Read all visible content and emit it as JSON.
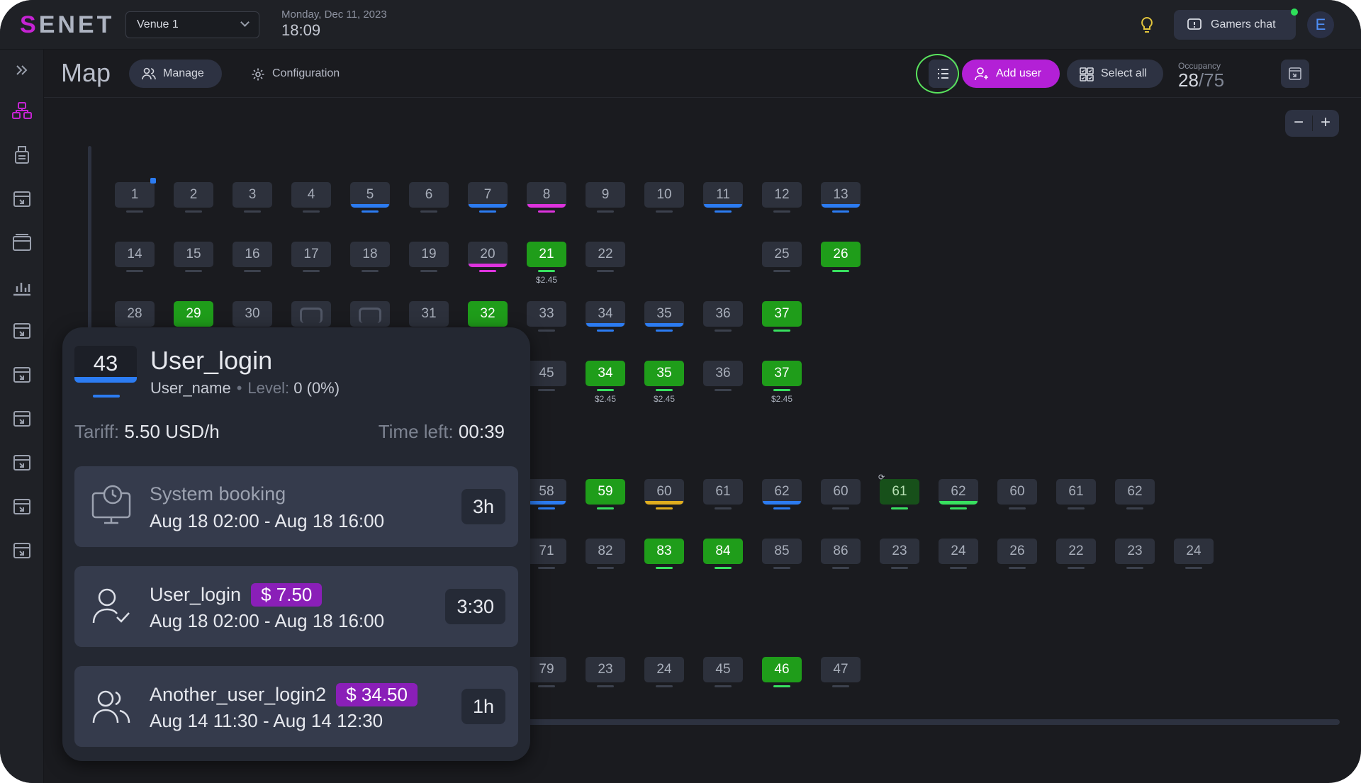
{
  "app": {
    "logo_s": "S",
    "logo_rest": "ENET",
    "venue": "Venue 1",
    "date": "Monday, Dec 11, 2023",
    "time": "18:09",
    "chat_label": "Gamers chat",
    "avatar_letter": "E",
    "brand_color": "#c623d4"
  },
  "header": {
    "title": "Map",
    "manage_label": "Manage",
    "config_label": "Configuration",
    "add_user_label": "Add user",
    "select_all_label": "Select all",
    "occupancy_label": "Occupancy",
    "occupancy_value": "28",
    "occupancy_total": "/75"
  },
  "zoom": {
    "minus": "−",
    "plus": "+"
  },
  "sidebar": {
    "icons": [
      "chevrons-right-icon",
      "map-icon",
      "printer-icon",
      "plugin-icon",
      "window-icon",
      "bar-chart-icon",
      "plugin-icon",
      "plugin-icon",
      "plugin-icon",
      "plugin-icon",
      "plugin-icon",
      "plugin-icon"
    ]
  },
  "computers": [
    {
      "n": "1",
      "state": "idle",
      "dot": true
    },
    {
      "n": "2",
      "state": "idle"
    },
    {
      "n": "3",
      "state": "idle"
    },
    {
      "n": "4",
      "state": "idle"
    },
    {
      "n": "5",
      "state": "idle",
      "accent": "blue"
    },
    {
      "n": "6",
      "state": "idle"
    },
    {
      "n": "7",
      "state": "idle",
      "accent": "blue"
    },
    {
      "n": "8",
      "state": "idle",
      "accent": "pink"
    },
    {
      "n": "9",
      "state": "idle"
    },
    {
      "n": "10",
      "state": "idle"
    },
    {
      "n": "11",
      "state": "idle",
      "accent": "blue"
    },
    {
      "n": "12",
      "state": "idle"
    },
    {
      "n": "13",
      "state": "idle",
      "accent": "blue"
    },
    {
      "n": "14",
      "state": "idle"
    },
    {
      "n": "15",
      "state": "idle"
    },
    {
      "n": "16",
      "state": "idle"
    },
    {
      "n": "17",
      "state": "idle"
    },
    {
      "n": "18",
      "state": "idle"
    },
    {
      "n": "19",
      "state": "idle"
    },
    {
      "n": "20",
      "state": "idle",
      "accent": "pink"
    },
    {
      "n": "21",
      "state": "active",
      "price": "$2.45"
    },
    {
      "n": "22",
      "state": "idle"
    },
    {
      "n": "25",
      "state": "idle"
    },
    {
      "n": "26",
      "state": "active"
    },
    {
      "n": "28",
      "state": "idle"
    },
    {
      "n": "29",
      "state": "active"
    },
    {
      "n": "30",
      "state": "idle"
    },
    {
      "n": "",
      "state": "console"
    },
    {
      "n": "",
      "state": "console"
    },
    {
      "n": "31",
      "state": "idle"
    },
    {
      "n": "32",
      "state": "active"
    },
    {
      "n": "33",
      "state": "idle"
    },
    {
      "n": "34",
      "state": "idle",
      "accent": "blue"
    },
    {
      "n": "35",
      "state": "idle",
      "accent": "blue"
    },
    {
      "n": "36",
      "state": "idle"
    },
    {
      "n": "37",
      "state": "active"
    },
    {
      "n": "45",
      "state": "idle"
    },
    {
      "n": "34",
      "state": "active",
      "price": "$2.45"
    },
    {
      "n": "35",
      "state": "active",
      "price": "$2.45"
    },
    {
      "n": "36",
      "state": "idle"
    },
    {
      "n": "37",
      "state": "active",
      "price": "$2.45"
    },
    {
      "n": "58",
      "state": "idle",
      "accent": "blue"
    },
    {
      "n": "59",
      "state": "active"
    },
    {
      "n": "60",
      "state": "idle",
      "accent": "yellow"
    },
    {
      "n": "61",
      "state": "idle"
    },
    {
      "n": "62",
      "state": "idle",
      "accent": "blue"
    },
    {
      "n": "60",
      "state": "idle"
    },
    {
      "n": "61",
      "state": "active-dark",
      "sync": true
    },
    {
      "n": "62",
      "state": "idle",
      "accent": "green"
    },
    {
      "n": "60",
      "state": "idle"
    },
    {
      "n": "61",
      "state": "idle"
    },
    {
      "n": "62",
      "state": "idle"
    },
    {
      "n": "71",
      "state": "idle"
    },
    {
      "n": "82",
      "state": "idle"
    },
    {
      "n": "83",
      "state": "active"
    },
    {
      "n": "84",
      "state": "active"
    },
    {
      "n": "85",
      "state": "idle"
    },
    {
      "n": "86",
      "state": "idle"
    },
    {
      "n": "23",
      "state": "idle"
    },
    {
      "n": "24",
      "state": "idle"
    },
    {
      "n": "26",
      "state": "idle"
    },
    {
      "n": "22",
      "state": "idle"
    },
    {
      "n": "23",
      "state": "idle"
    },
    {
      "n": "24",
      "state": "idle"
    },
    {
      "n": "79",
      "state": "idle"
    },
    {
      "n": "23",
      "state": "idle"
    },
    {
      "n": "24",
      "state": "idle"
    },
    {
      "n": "45",
      "state": "idle"
    },
    {
      "n": "46",
      "state": "active"
    },
    {
      "n": "47",
      "state": "idle"
    }
  ],
  "popup": {
    "number": "43",
    "login": "User_login",
    "name": "User_name",
    "level_label": "Level:",
    "level_value": "0 (0%)",
    "tariff_label": "Tariff:",
    "tariff_value": "5.50 USD/h",
    "time_left_label": "Time left:",
    "time_left_value": "00:39",
    "bookings": [
      {
        "title": "System booking",
        "price": "",
        "period": "Aug 18 02:00  -  Aug 18 16:00",
        "duration": "3h",
        "icon": "clock-monitor-icon"
      },
      {
        "title": "User_login",
        "price": "$ 7.50",
        "period": "Aug 18 02:00  -  Aug 18 16:00",
        "duration": "3:30",
        "icon": "user-check-icon"
      },
      {
        "title": "Another_user_login2",
        "price": "$ 34.50",
        "period": "Aug 14 11:30  -  Aug 14 12:30",
        "duration": "1h",
        "icon": "users-icon"
      }
    ]
  }
}
